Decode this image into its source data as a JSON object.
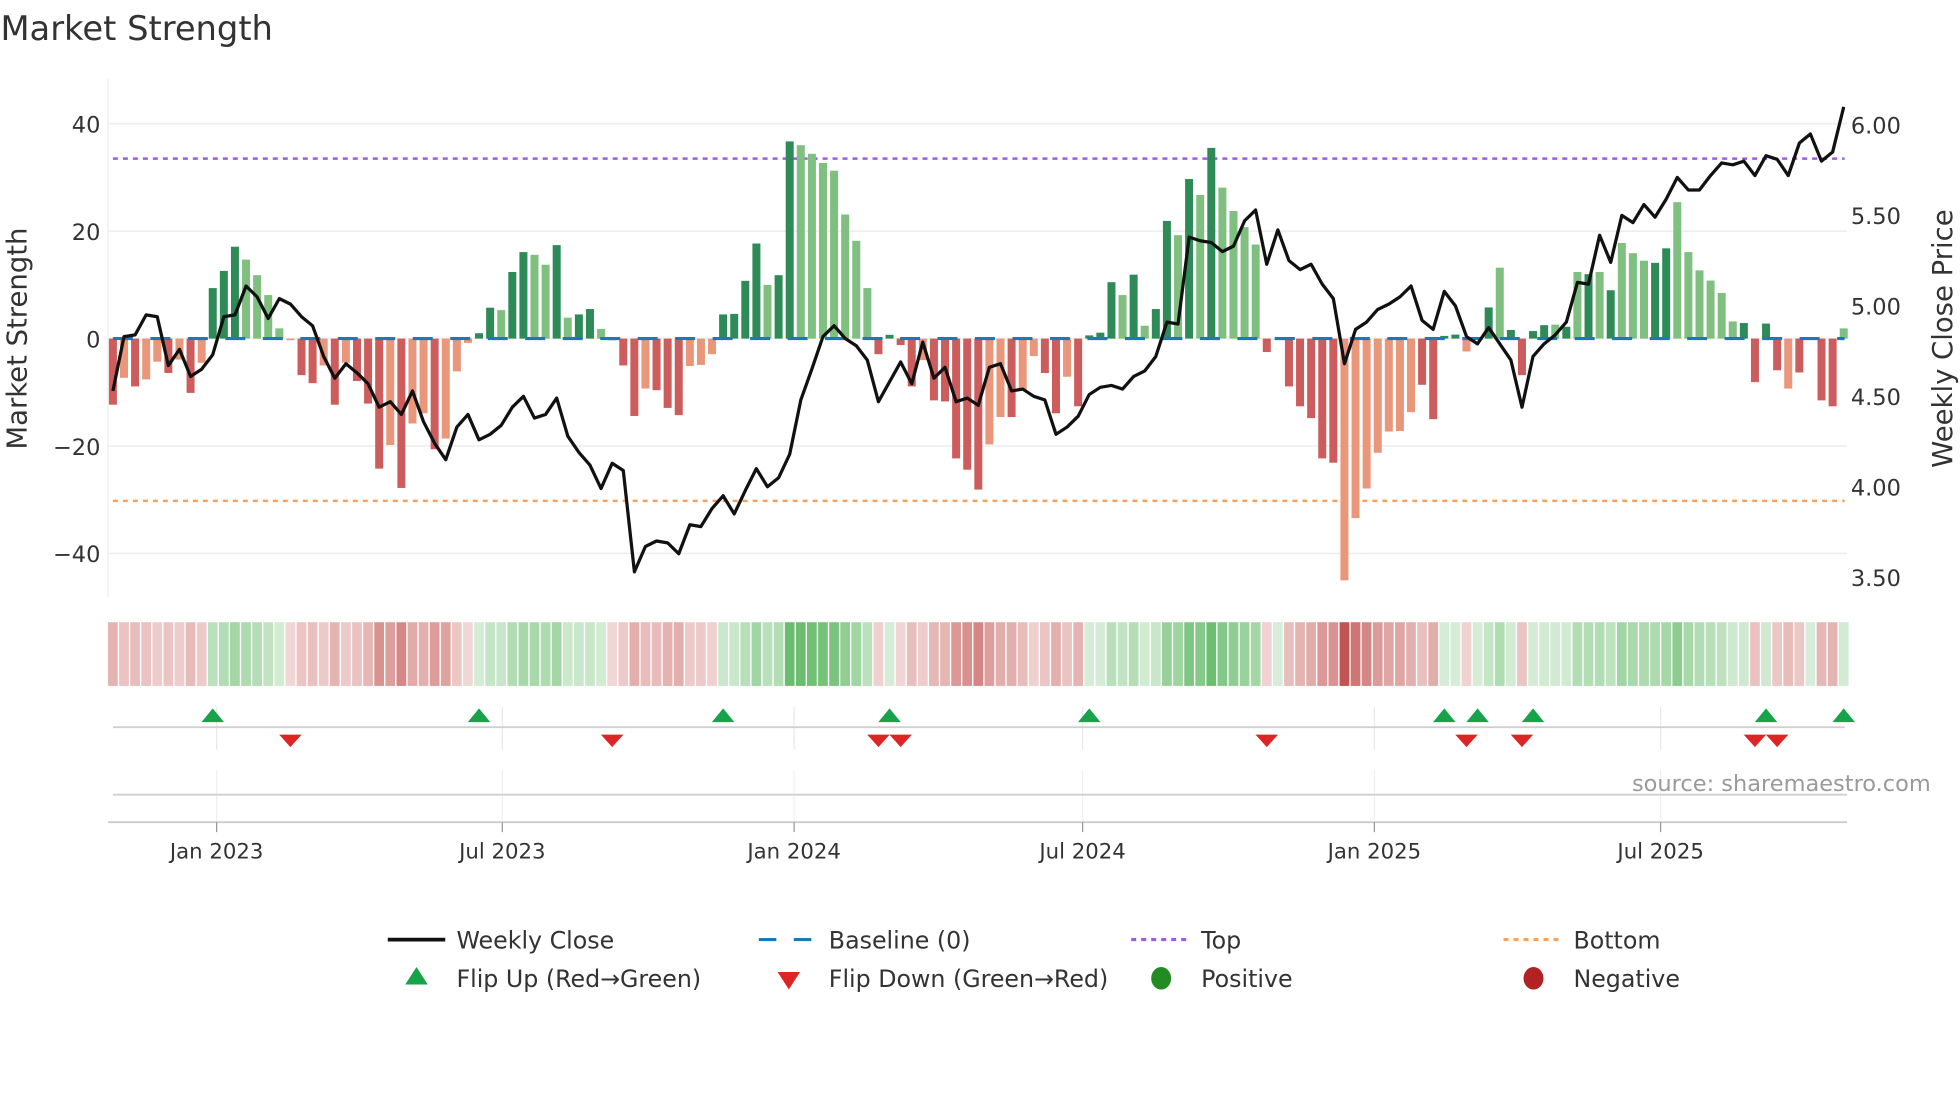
{
  "chart_data": {
    "type": "bar",
    "title": "Market Strength",
    "ylabel": "Market Strength",
    "y2label": "Weekly Close Price",
    "ylim": [
      -48,
      48.5
    ],
    "y2lim": [
      3.38,
      6.25
    ],
    "yticks": [
      "40",
      "20",
      "0",
      "−20",
      "−40"
    ],
    "ytick_values": [
      40,
      20,
      0,
      -20,
      -40
    ],
    "y2ticks": [
      "6.00",
      "5.50",
      "5.00",
      "4.50",
      "4.00",
      "3.50"
    ],
    "y2tick_values": [
      6.0,
      5.5,
      5.0,
      4.5,
      4.0,
      3.5
    ],
    "xticks": [
      {
        "label": "Jan 2023",
        "week": 9.35
      },
      {
        "label": "Jul 2023",
        "week": 35.1
      },
      {
        "label": "Jan 2024",
        "week": 61.4
      },
      {
        "label": "Jul 2024",
        "week": 87.4
      },
      {
        "label": "Jan 2025",
        "week": 113.7
      },
      {
        "label": "Jul 2025",
        "week": 139.5
      }
    ],
    "grid": true,
    "top_level": 33.5,
    "bottom_level": -30.2,
    "baseline": 0,
    "strength": [
      -12.3,
      -7.3,
      -8.9,
      -7.6,
      -4.3,
      -6.4,
      -3.9,
      -10.1,
      -4.5,
      9.4,
      12.6,
      17.1,
      14.7,
      11.8,
      8.1,
      1.9,
      -0.3,
      -6.8,
      -8.3,
      -5,
      -12.3,
      -4.5,
      -7.9,
      -12.1,
      -24.2,
      -19.8,
      -27.8,
      -15.8,
      -13.9,
      -20.6,
      -18.6,
      -6.1,
      -0.8,
      1,
      5.75,
      5.3,
      12.4,
      16.1,
      15.6,
      13.75,
      17.4,
      3.9,
      4.5,
      5.5,
      1.8,
      -0.3,
      -5,
      -14.4,
      -9.3,
      -9.6,
      -12.9,
      -14.25,
      -5.1,
      -4.9,
      -2.9,
      4.5,
      4.6,
      10.75,
      17.7,
      10,
      11.8,
      36.7,
      36,
      34.4,
      32.7,
      31.25,
      23.1,
      18.2,
      9.4,
      -2.9,
      0.7,
      -1.2,
      -8.9,
      -4,
      -11.5,
      -11.7,
      -22.3,
      -24.4,
      -28.1,
      -19.7,
      -14.6,
      -14.6,
      -9.5,
      -3.25,
      -6.4,
      -13.9,
      -7.1,
      -12.6,
      0.6,
      1.1,
      10.5,
      8.1,
      11.9,
      2.4,
      5.5,
      21.9,
      19.25,
      29.7,
      26.75,
      35.5,
      28.1,
      23.75,
      20.75,
      17.5,
      -2.5,
      0,
      -8.9,
      -12.6,
      -14.8,
      -22.3,
      -23.1,
      -45,
      -33.4,
      -27.9,
      -21.25,
      -17.3,
      -17.2,
      -13.7,
      -8.6,
      -15,
      0.5,
      0.75,
      -2.4,
      0.3,
      5.8,
      13.2,
      1.6,
      -6.8,
      1.4,
      2.5,
      2.6,
      2.2,
      12.4,
      12,
      12.4,
      9,
      17.8,
      15.9,
      14.5,
      14.1,
      16.8,
      25.4,
      16.1,
      12.7,
      10.8,
      8.5,
      3.2,
      2.9,
      -8.1,
      2.8,
      -5.9,
      -9.3,
      -6.3,
      0,
      -11.5,
      -12.6,
      1.9
    ],
    "strong": "DLDLLDLDLDDDLLLLLDDLDLDDDLDLLDLLLDDLDDLLDLDDLDDDLDDDLLLDDDDLDDLLLLLLLDDDDLDDDDDLLDLLDDLDDDDLDLDDLDLDLLLLDDDDDDDLLLLLLLDDDDLDDLDDDDLDLDLDLLLDDLLLLLLDDDDLDDDD",
    "weekly_close": [
      4.53,
      4.83,
      4.84,
      4.95,
      4.94,
      4.67,
      4.76,
      4.61,
      4.65,
      4.73,
      4.94,
      4.95,
      5.11,
      5.05,
      4.93,
      5.04,
      5.01,
      4.94,
      4.89,
      4.72,
      4.6,
      4.68,
      4.63,
      4.57,
      4.44,
      4.47,
      4.4,
      4.53,
      4.36,
      4.24,
      4.15,
      4.33,
      4.4,
      4.26,
      4.29,
      4.34,
      4.44,
      4.5,
      4.38,
      4.4,
      4.49,
      4.28,
      4.19,
      4.12,
      3.99,
      4.13,
      4.09,
      3.53,
      3.67,
      3.7,
      3.69,
      3.63,
      3.79,
      3.78,
      3.88,
      3.95,
      3.85,
      3.98,
      4.1,
      4,
      4.05,
      4.18,
      4.48,
      4.65,
      4.83,
      4.89,
      4.82,
      4.78,
      4.7,
      4.47,
      4.58,
      4.69,
      4.57,
      4.8,
      4.6,
      4.66,
      4.47,
      4.49,
      4.45,
      4.66,
      4.68,
      4.53,
      4.54,
      4.5,
      4.48,
      4.29,
      4.33,
      4.39,
      4.51,
      4.55,
      4.56,
      4.54,
      4.61,
      4.64,
      4.72,
      4.91,
      4.9,
      5.38,
      5.36,
      5.35,
      5.3,
      5.33,
      5.47,
      5.53,
      5.23,
      5.42,
      5.25,
      5.2,
      5.23,
      5.12,
      5.04,
      4.68,
      4.87,
      4.91,
      4.98,
      5.01,
      5.05,
      5.11,
      4.92,
      4.87,
      5.08,
      5,
      4.83,
      4.79,
      4.88,
      4.79,
      4.7,
      4.44,
      4.72,
      4.79,
      4.84,
      4.91,
      5.13,
      5.12,
      5.39,
      5.24,
      5.5,
      5.46,
      5.56,
      5.49,
      5.59,
      5.71,
      5.64,
      5.64,
      5.72,
      5.79,
      5.78,
      5.8,
      5.72,
      5.83,
      5.81,
      5.72,
      5.9,
      5.95,
      5.8,
      5.85,
      6.1
    ],
    "flip_up_weeks": [
      9,
      33,
      55,
      70,
      88,
      120,
      123,
      128,
      149,
      156
    ],
    "flip_down_weeks": [
      16,
      45,
      69,
      71,
      104,
      122,
      127,
      148,
      150
    ],
    "legend_placement": "bottom-center"
  },
  "colors": {
    "pos_strong": "#2e8b57",
    "pos_weak": "#7fbf7f",
    "neg_strong": "#cd5c5c",
    "neg_weak": "#e9967a",
    "heat_pos": "#4caf50",
    "heat_neg": "#c0504d",
    "close": "#111111",
    "baseline": "#1f77b4",
    "top": "#9b5de5",
    "bottom": "#f4a261",
    "flip_up": "#16a34a",
    "flip_down": "#dc2626",
    "positive": "#228b22",
    "negative": "#b22222"
  },
  "legend": {
    "weekly_close": "Weekly Close",
    "baseline": "Baseline (0)",
    "top": "Top",
    "bottom": "Bottom",
    "flip_up": "Flip Up (Red→Green)",
    "flip_down": "Flip Down (Green→Red)",
    "positive": "Positive",
    "negative": "Negative"
  },
  "source": "source: sharemaestro.com"
}
